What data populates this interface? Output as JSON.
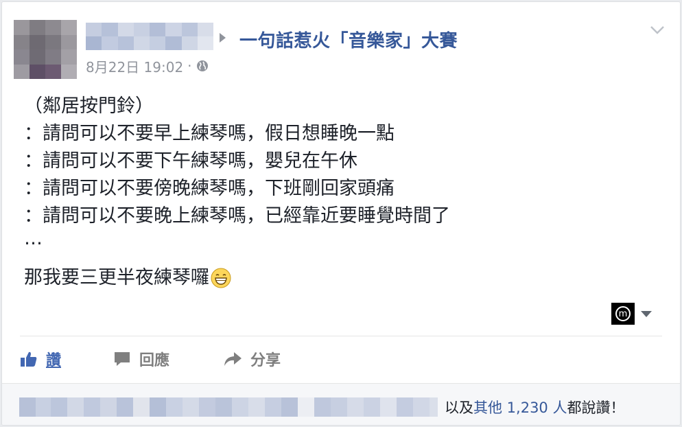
{
  "post": {
    "group_name": "一句話惹火「音樂家」大賽",
    "timestamp": "8月22日 19:02",
    "separator": "·",
    "privacy_icon": "globe-icon",
    "body_lines": [
      "（鄰居按門鈴）",
      "：請問可以不要早上練琴嗎，假日想睡晚一點",
      "：請問可以不要下午練琴嗎，嬰兒在午休",
      "：請問可以不要傍晚練琴嗎，下班剛回家頭痛",
      "：請問可以不要晚上練琴嗎，已經靠近要睡覺時間了"
    ],
    "ellipsis": "…",
    "last_line": "那我要三更半夜練琴囉",
    "emoji_icon": "grinning-face-icon",
    "badge_letter": "m"
  },
  "actions": {
    "like_label": "讚",
    "comment_label": "回應",
    "share_label": "分享"
  },
  "footer": {
    "likes_prefix": "以及",
    "likes_others": "其他 1,230 人",
    "likes_suffix": "都說讚！"
  },
  "colors": {
    "link_blue": "#365899",
    "like_blue": "#4267b2",
    "meta_gray": "#90949c",
    "action_gray": "#7f7f7f"
  }
}
